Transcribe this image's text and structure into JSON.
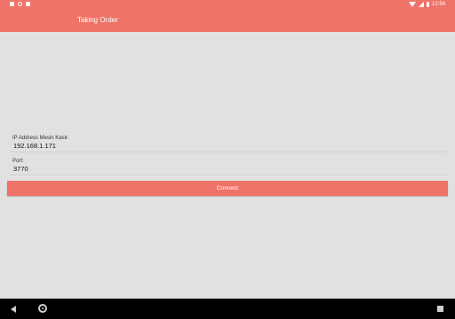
{
  "status_bar": {
    "left_icons": [
      "notification-square-icon",
      "sync-icon",
      "sd-card-icon"
    ],
    "right_icons": [
      "wifi-icon",
      "signal-icon",
      "battery-icon"
    ],
    "time": "12:54"
  },
  "app_bar": {
    "title": "Taking Order"
  },
  "form": {
    "ip_label": "IP Address Mesin Kasir:",
    "ip_value": "192.168.1.171",
    "port_label": "Port:",
    "port_value": "3770"
  },
  "actions": {
    "connect_label": "Connect"
  },
  "nav_bar": {
    "icons": [
      "back-icon",
      "home-icon",
      "recents-icon"
    ]
  },
  "colors": {
    "primary": "#ef7368",
    "background": "#e1e1e1",
    "navbar": "#000000"
  }
}
